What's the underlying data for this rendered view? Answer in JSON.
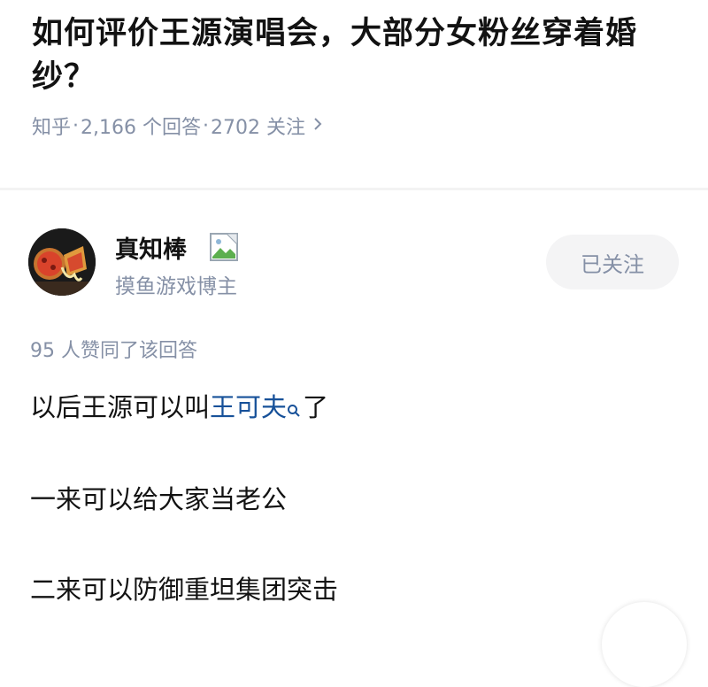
{
  "question": {
    "title": "如何评价王源演唱会，大部分女粉丝穿着婚纱？",
    "source": "知乎",
    "answer_count": "2,166 个回答",
    "follow_count": "2702 关注",
    "separator": "·"
  },
  "author": {
    "name": "真知棒",
    "description": "摸鱼游戏博主",
    "follow_label": "已关注",
    "avatar_icon": "pizza-avatar",
    "badge_icon": "broken-image-icon"
  },
  "answer": {
    "voteup_text": "95 人赞同了该回答",
    "paragraph1_prefix": "以后王源可以叫",
    "paragraph1_link": "王可夫",
    "paragraph1_suffix": "了",
    "paragraph2": "一来可以给大家当老公",
    "paragraph3": "二来可以防御重坦集团突击"
  },
  "colors": {
    "text_primary": "#121212",
    "text_secondary": "#8590a6",
    "link": "#175199",
    "button_bg": "#f4f4f5"
  }
}
